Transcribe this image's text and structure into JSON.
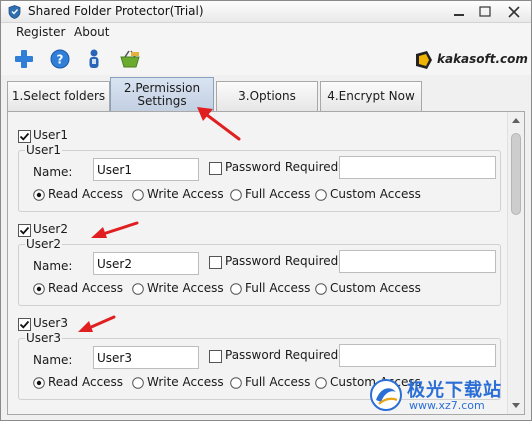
{
  "window": {
    "title": "Shared Folder Protector(Trial)"
  },
  "menu": [
    {
      "label": "Register"
    },
    {
      "label": "About"
    }
  ],
  "toolbar": {
    "icons": [
      "add-icon",
      "help-icon",
      "user-icon",
      "basket-icon"
    ]
  },
  "brand": {
    "text": "kakasoft.com"
  },
  "tabs": [
    {
      "label_line1": "1.Select folders",
      "label_line2": "",
      "active": false
    },
    {
      "label_line1": "2.Permission",
      "label_line2": "Settings",
      "active": true
    },
    {
      "label_line1": "3.Options",
      "label_line2": "",
      "active": false
    },
    {
      "label_line1": "4.Encrypt Now",
      "label_line2": "",
      "active": false
    }
  ],
  "users": [
    {
      "checked": true,
      "check_label": "User1",
      "group_label": "User1",
      "name_label": "Name:",
      "name_value": "User1",
      "password_required_label": "Password Required",
      "password_required": false,
      "password_value": "",
      "access_options": [
        "Read Access",
        "Write Access",
        "Full Access",
        "Custom Access"
      ],
      "selected_access": "Read Access"
    },
    {
      "checked": true,
      "check_label": "User2",
      "group_label": "User2",
      "name_label": "Name:",
      "name_value": "User2",
      "password_required_label": "Password Required",
      "password_required": false,
      "password_value": "",
      "access_options": [
        "Read Access",
        "Write Access",
        "Full Access",
        "Custom Access"
      ],
      "selected_access": "Read Access"
    },
    {
      "checked": true,
      "check_label": "User3",
      "group_label": "User3",
      "name_label": "Name:",
      "name_value": "User3",
      "password_required_label": "Password Required",
      "password_required": false,
      "password_value": "",
      "access_options": [
        "Read Access",
        "Write Access",
        "Full Access",
        "Custom Access"
      ],
      "selected_access": "Read Access"
    }
  ],
  "watermark": {
    "title": "极光下载站",
    "url": "www.xz7.com"
  },
  "colors": {
    "accent_arrow": "#e02020",
    "active_tab": "#c3d0e2",
    "watermark_blue": "#2b6fd6"
  }
}
